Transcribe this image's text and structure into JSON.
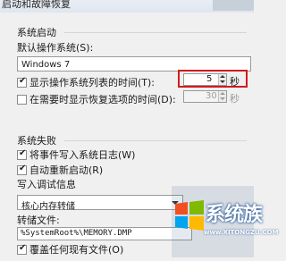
{
  "window": {
    "title": "启动和故障恢复"
  },
  "system_startup": {
    "group_label": "系统启动",
    "default_os_label": "默认操作系统(S):",
    "default_os_value": "Windows 7",
    "show_os_list_label": "显示操作系统列表的时间(T):",
    "show_os_list_checked": true,
    "show_os_list_value": "5",
    "show_os_list_unit": "秒",
    "show_recovery_label": "在需要时显示恢复选项的时间(D):",
    "show_recovery_checked": false,
    "show_recovery_value": "30",
    "show_recovery_unit": "秒"
  },
  "system_failure": {
    "group_label": "系统失败",
    "write_event_label": "将事件写入系统日志(W)",
    "write_event_checked": true,
    "auto_restart_label": "自动重新启动(R)",
    "auto_restart_checked": true,
    "debug_info_label": "写入调试信息",
    "debug_info_value": "核心内存转储",
    "dump_file_label": "转储文件:",
    "dump_file_value": "%SystemRoot%\\MEMORY.DMP",
    "overwrite_label": "覆盖任何现有文件(O)",
    "overwrite_checked": true
  },
  "watermark": {
    "brand_text": "系统族",
    "url_text": "www.XITONGZU.COM",
    "colors": [
      "#f25022",
      "#7fba00",
      "#00a4ef",
      "#ffb900"
    ]
  },
  "colors": {
    "highlight": "#d11b1b"
  }
}
